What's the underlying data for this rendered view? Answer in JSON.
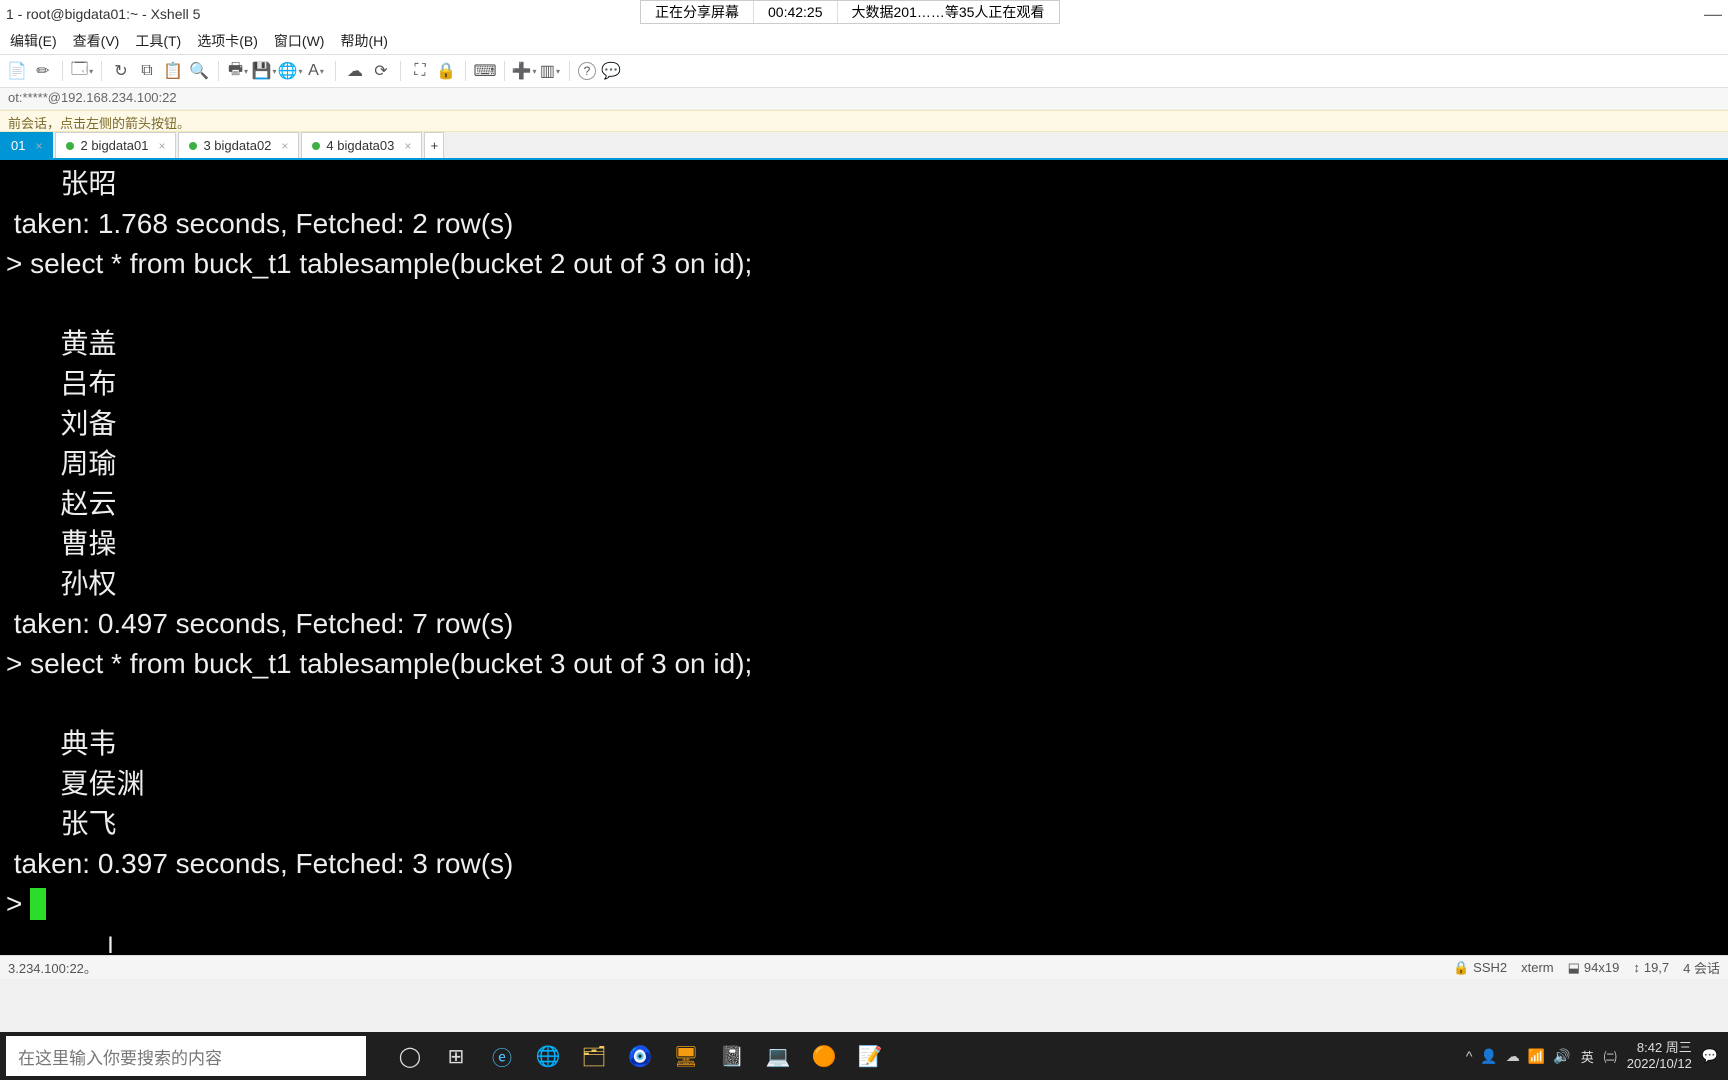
{
  "title_bar": {
    "text": "1 - root@bigdata01:~ - Xshell 5",
    "minimize": "—"
  },
  "share_overlay": {
    "status": "正在分享屏幕",
    "timer": "00:42:25",
    "viewers": "大数据201……等35人正在观看"
  },
  "menu": {
    "edit": "编辑(E)",
    "view": "查看(V)",
    "tools": "工具(T)",
    "tabs": "选项卡(B)",
    "window": "窗口(W)",
    "help": "帮助(H)"
  },
  "addr": "ot:*****@192.168.234.100:22",
  "hint": "前会话，点击左侧的箭头按钮。",
  "tabs": {
    "t1": "01",
    "t2": "2 bigdata01",
    "t3": "3 bigdata02",
    "t4": "4 bigdata03",
    "add": "+"
  },
  "terminal_lines": {
    "l0": "       张昭",
    "l1": " taken: 1.768 seconds, Fetched: 2 row(s)",
    "l2": "> select * from buck_t1 tablesample(bucket 2 out of 3 on id);",
    "l3": "",
    "l4": "       黄盖",
    "l5": "       吕布",
    "l6": "       刘备",
    "l7": "       周瑜",
    "l8": "       赵云",
    "l9": "       曹操",
    "l10": "       孙权",
    "l11": " taken: 0.497 seconds, Fetched: 7 row(s)",
    "l12": "> select * from buck_t1 tablesample(bucket 3 out of 3 on id);",
    "l13": "",
    "l14": "       典韦",
    "l15": "       夏侯渊",
    "l16": "       张飞",
    "l17": " taken: 0.397 seconds, Fetched: 3 row(s)",
    "l18": "> "
  },
  "status": {
    "left": "3.234.100:22。",
    "ssh": "SSH2",
    "term": "xterm",
    "size": "94x19",
    "pos": "19,7",
    "sessions": "4 会话"
  },
  "taskbar": {
    "search_placeholder": "在这里输入你要搜索的内容",
    "ime": "英",
    "ime2": "㈡",
    "clock_time": "8:42 周三",
    "clock_date": "2022/10/12"
  },
  "icons": {
    "lock": "🔒",
    "copy": "⧉",
    "paste": "📋",
    "search": "🔍",
    "globe": "🌐",
    "font": "A",
    "reload": "⟳",
    "cog": "⚙",
    "expand": "⛶",
    "padlock": "🔒",
    "kbd": "⌨",
    "plus": "➕",
    "cols": "▥",
    "help": "?",
    "chat": "💬",
    "circle": "◯"
  }
}
